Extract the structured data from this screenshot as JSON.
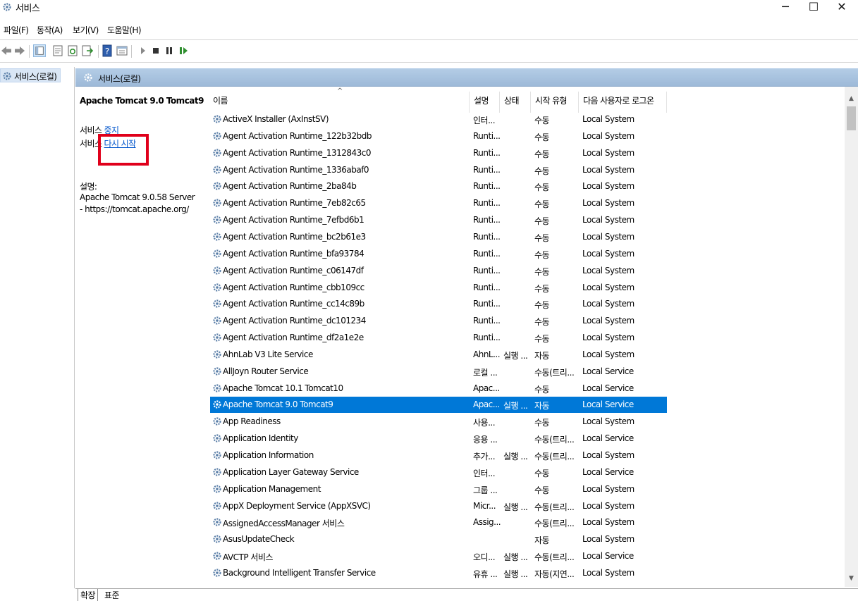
{
  "window": {
    "title": "서비스",
    "minimize": "─",
    "maximize": "☐",
    "close": "✕"
  },
  "menu": [
    "파일(F)",
    "동작(A)",
    "보기(V)",
    "도움말(H)"
  ],
  "toolbar": {
    "icons": [
      "back-icon",
      "forward-icon",
      "show-hide-console-tree-icon",
      "properties-icon",
      "refresh-icon",
      "export-list-icon",
      "help-icon",
      "console-icon",
      "start-service-icon",
      "stop-service-icon",
      "pause-service-icon",
      "restart-service-icon"
    ]
  },
  "tree": {
    "node_label": "서비스(로컬)"
  },
  "panel": {
    "header": "서비스(로컬)"
  },
  "details": {
    "service_title": "Apache Tomcat 9.0 Tomcat9",
    "stop_prefix": "서비스 ",
    "stop_link": "중지",
    "restart_prefix": "서비스 ",
    "restart_link": "다시 시작",
    "desc_label": "설명:",
    "description": "Apache Tomcat 9.0.58 Server - https://tomcat.apache.org/"
  },
  "columns": {
    "name": "이름",
    "description": "설명",
    "status": "상태",
    "startup_type": "시작 유형",
    "logon_as": "다음 사용자로 로그온"
  },
  "rows": [
    {
      "name": "ActiveX Installer (AxInstSV)",
      "desc": "인터...",
      "status": "",
      "start": "수동",
      "logon": "Local System"
    },
    {
      "name": "Agent Activation Runtime_122b32bdb",
      "desc": "Runti...",
      "status": "",
      "start": "수동",
      "logon": "Local System"
    },
    {
      "name": "Agent Activation Runtime_1312843c0",
      "desc": "Runti...",
      "status": "",
      "start": "수동",
      "logon": "Local System"
    },
    {
      "name": "Agent Activation Runtime_1336abaf0",
      "desc": "Runti...",
      "status": "",
      "start": "수동",
      "logon": "Local System"
    },
    {
      "name": "Agent Activation Runtime_2ba84b",
      "desc": "Runti...",
      "status": "",
      "start": "수동",
      "logon": "Local System"
    },
    {
      "name": "Agent Activation Runtime_7eb82c65",
      "desc": "Runti...",
      "status": "",
      "start": "수동",
      "logon": "Local System"
    },
    {
      "name": "Agent Activation Runtime_7efbd6b1",
      "desc": "Runti...",
      "status": "",
      "start": "수동",
      "logon": "Local System"
    },
    {
      "name": "Agent Activation Runtime_bc2b61e3",
      "desc": "Runti...",
      "status": "",
      "start": "수동",
      "logon": "Local System"
    },
    {
      "name": "Agent Activation Runtime_bfa93784",
      "desc": "Runti...",
      "status": "",
      "start": "수동",
      "logon": "Local System"
    },
    {
      "name": "Agent Activation Runtime_c06147df",
      "desc": "Runti...",
      "status": "",
      "start": "수동",
      "logon": "Local System"
    },
    {
      "name": "Agent Activation Runtime_cbb109cc",
      "desc": "Runti...",
      "status": "",
      "start": "수동",
      "logon": "Local System"
    },
    {
      "name": "Agent Activation Runtime_cc14c89b",
      "desc": "Runti...",
      "status": "",
      "start": "수동",
      "logon": "Local System"
    },
    {
      "name": "Agent Activation Runtime_dc101234",
      "desc": "Runti...",
      "status": "",
      "start": "수동",
      "logon": "Local System"
    },
    {
      "name": "Agent Activation Runtime_df2a1e2e",
      "desc": "Runti...",
      "status": "",
      "start": "수동",
      "logon": "Local System"
    },
    {
      "name": "AhnLab V3 Lite Service",
      "desc": "AhnL...",
      "status": "실행 ...",
      "start": "자동",
      "logon": "Local System"
    },
    {
      "name": "AllJoyn Router Service",
      "desc": "로컬 ...",
      "status": "",
      "start": "수동(트리...",
      "logon": "Local Service"
    },
    {
      "name": "Apache Tomcat 10.1 Tomcat10",
      "desc": "Apac...",
      "status": "",
      "start": "수동",
      "logon": "Local Service"
    },
    {
      "name": "Apache Tomcat 9.0 Tomcat9",
      "desc": "Apac...",
      "status": "실행 ...",
      "start": "자동",
      "logon": "Local Service",
      "selected": true
    },
    {
      "name": "App Readiness",
      "desc": "사용...",
      "status": "",
      "start": "수동",
      "logon": "Local System"
    },
    {
      "name": "Application Identity",
      "desc": "응용 ...",
      "status": "",
      "start": "수동(트리...",
      "logon": "Local Service"
    },
    {
      "name": "Application Information",
      "desc": "추가...",
      "status": "실행 ...",
      "start": "수동(트리...",
      "logon": "Local System"
    },
    {
      "name": "Application Layer Gateway Service",
      "desc": "인터...",
      "status": "",
      "start": "수동",
      "logon": "Local Service"
    },
    {
      "name": "Application Management",
      "desc": "그룹 ...",
      "status": "",
      "start": "수동",
      "logon": "Local System"
    },
    {
      "name": "AppX Deployment Service (AppXSVC)",
      "desc": "Micr...",
      "status": "실행 ...",
      "start": "수동(트리...",
      "logon": "Local System"
    },
    {
      "name": "AssignedAccessManager 서비스",
      "desc": "Assig...",
      "status": "",
      "start": "수동(트리...",
      "logon": "Local System"
    },
    {
      "name": "AsusUpdateCheck",
      "desc": "",
      "status": "",
      "start": "자동",
      "logon": "Local System"
    },
    {
      "name": "AVCTP 서비스",
      "desc": "오디...",
      "status": "실행 ...",
      "start": "수동(트리...",
      "logon": "Local Service"
    },
    {
      "name": "Background Intelligent Transfer Service",
      "desc": "유휴 ...",
      "status": "실행 ...",
      "start": "자동(지연...",
      "logon": "Local System"
    }
  ],
  "tabs": {
    "extended": "확장",
    "standard": "표준"
  },
  "colors": {
    "selection": "#0078d7",
    "panel_header": "#a9c4e2",
    "link": "#0055cc",
    "highlight_box": "#e0001b"
  }
}
